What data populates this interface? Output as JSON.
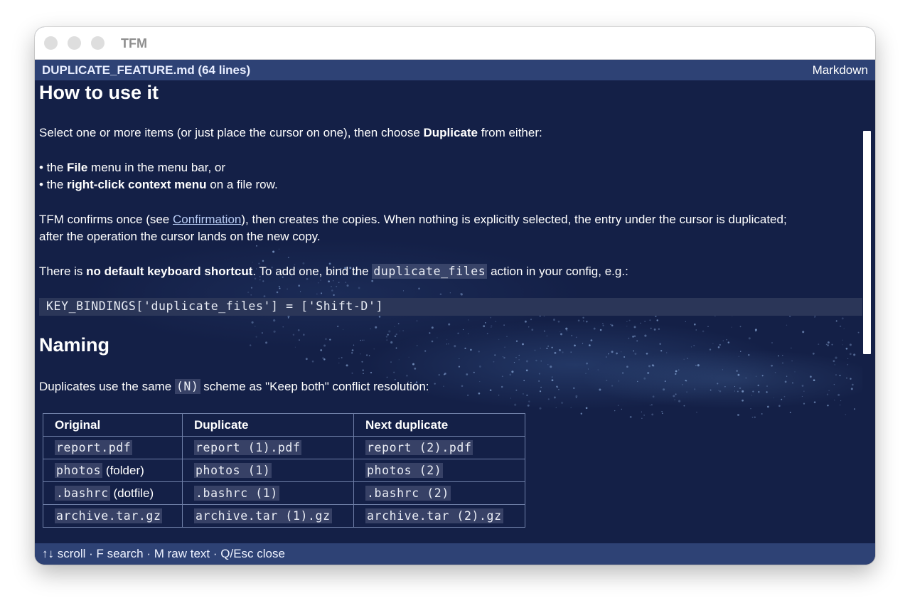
{
  "window": {
    "title": "TFM"
  },
  "header": {
    "filename": "DUPLICATE_FEATURE.md  (64 lines)",
    "mode": "Markdown"
  },
  "doc": {
    "h_how": "How to use it",
    "p1_a": "Select one or more items (or just place the cursor on one), then choose ",
    "p1_b": "Duplicate",
    "p1_c": " from either:",
    "li1_a": "• the ",
    "li1_b": "File",
    "li1_c": " menu in the menu bar, or",
    "li2_a": "• the ",
    "li2_b": "right-click context menu",
    "li2_c": " on a file row.",
    "p2_a": "TFM confirms once (see ",
    "p2_link": "Confirmation",
    "p2_b": "), then creates the copies. When nothing is explicitly selected, the entry under the cursor is duplicated;",
    "p2_c": "after the operation the cursor lands on the new copy.",
    "p3_a": "There is ",
    "p3_b": "no default keyboard shortcut",
    "p3_c": ". To add one, bind the ",
    "p3_code": "duplicate_files",
    "p3_d": " action in your config, e.g.:",
    "codeblock": "KEY_BINDINGS['duplicate_files'] = ['Shift-D']",
    "h_naming": "Naming",
    "p4_a": "Duplicates use the same ",
    "p4_code": " (N)",
    "p4_b": " scheme as \"Keep both\" conflict resolution:"
  },
  "table": {
    "headers": [
      "Original",
      "Duplicate",
      "Next duplicate"
    ],
    "rows": [
      {
        "orig": "report.pdf",
        "orig_note": "",
        "dup": "report (1).pdf",
        "next": "report (2).pdf"
      },
      {
        "orig": "photos",
        "orig_note": " (folder)",
        "dup": "photos (1)",
        "next": "photos (2)"
      },
      {
        "orig": ".bashrc",
        "orig_note": " (dotfile)",
        "dup": ".bashrc (1)",
        "next": ".bashrc (2)"
      },
      {
        "orig": "archive.tar.gz",
        "orig_note": "",
        "dup": "archive.tar (1).gz",
        "next": "archive.tar (2).gz"
      }
    ]
  },
  "footer": {
    "help": "↑↓ scroll · F search · M raw text · Q/Esc close"
  },
  "colors": {
    "background": "#142047",
    "bar": "#2e4275",
    "text": "#ffffff",
    "code_bg": "#2b3658"
  }
}
